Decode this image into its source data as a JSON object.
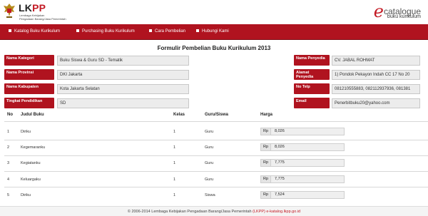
{
  "header": {
    "brand_a": "LK",
    "brand_b": "PP",
    "brand_sub1": "Lembaga Kebijakan",
    "brand_sub2": "Pengadaan Barang/Jasa Pemerintah",
    "ecat_e": "e",
    "ecat_word": "catalogue",
    "ecat_sub": "buku kurikulum"
  },
  "nav": {
    "items": [
      {
        "label": "Katalog Buku Kurikulum"
      },
      {
        "label": "Purchasing Buku Kurikulum"
      },
      {
        "label": "Cara Pembelian"
      },
      {
        "label": "Hubungi Kami"
      }
    ]
  },
  "form": {
    "title": "Formulir Pembelian Buku Kurikulum 2013",
    "left": [
      {
        "label": "Nama Kategori",
        "value": "Buku Siswa & Guru SD - Tematik"
      },
      {
        "label": "Nama Provinsi",
        "value": "DKI Jakarta"
      },
      {
        "label": "Nama Kabupaten",
        "value": "Kota Jakarta Selatan"
      },
      {
        "label": "Tingkat Pendidikan",
        "value": "SD"
      }
    ],
    "right": [
      {
        "label": "Nama Penyedia",
        "value": "CV. JABAL ROHMAT"
      },
      {
        "label": "Alamat Penyedia",
        "value": "1) Pondok Pekayon Indah CC 17 No 20"
      },
      {
        "label": "No Telp",
        "value": "081210555883, 082112937936, 081381"
      },
      {
        "label": "Email",
        "value": "Penerbitbuku20@yahoo.com"
      }
    ]
  },
  "table": {
    "headers": {
      "no": "No",
      "judul": "Judul Buku",
      "kelas": "Kelas",
      "guru": "Guru/Siswa",
      "harga": "Harga"
    },
    "currency": "Rp",
    "rows": [
      {
        "no": "1",
        "judul": "Diriku",
        "kelas": "1",
        "guru": "Guru",
        "harga": "8,026"
      },
      {
        "no": "2",
        "judul": "Kegemaranku",
        "kelas": "1",
        "guru": "Guru",
        "harga": "8,026"
      },
      {
        "no": "3",
        "judul": "Kegiatanku",
        "kelas": "1",
        "guru": "Guru",
        "harga": "7,775"
      },
      {
        "no": "4",
        "judul": "Keluargaku",
        "kelas": "1",
        "guru": "Guru",
        "harga": "7,775"
      },
      {
        "no": "5",
        "judul": "Diriku",
        "kelas": "1",
        "guru": "Siswa",
        "harga": "7,524"
      }
    ]
  },
  "footer": {
    "text": "© 2006-2014 Lembaga Kebijakan Pengadaan Barang/Jasa Pemerintah ",
    "red": "(LKPP) e-katalog.lkpp.go.id"
  },
  "colors": {
    "accent": "#b0131f",
    "brand_red": "#c31a24"
  }
}
